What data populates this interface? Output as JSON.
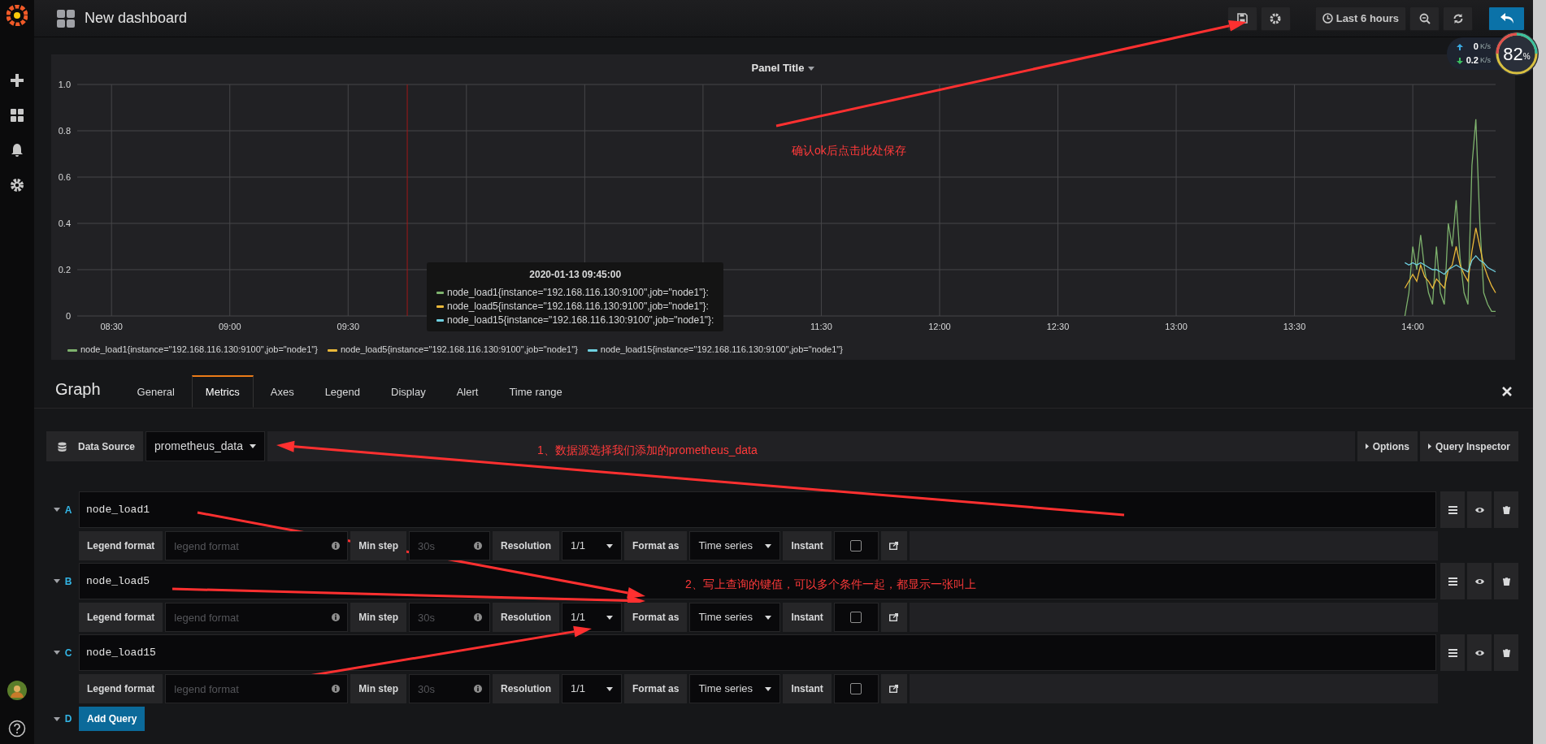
{
  "header": {
    "title": "New dashboard",
    "time_range": "Last 6 hours"
  },
  "net_monitor": {
    "upload": "0",
    "upload_unit": "K/s",
    "download": "0.2",
    "download_unit": "K/s",
    "percent": "82",
    "percent_sign": "%"
  },
  "panel": {
    "title": "Panel Title",
    "chart_data": {
      "type": "line",
      "grid": true,
      "ref_lines": [
        {
          "axis": "x",
          "value": 585,
          "color": "#a01818"
        }
      ],
      "x": [
        838,
        839,
        840,
        841,
        842,
        843,
        844,
        845,
        846,
        847,
        848,
        849,
        850,
        851,
        852,
        853,
        854,
        855,
        856,
        857,
        858,
        859,
        860,
        861
      ],
      "xlim": [
        501.3,
        861
      ],
      "ylim": [
        0,
        1
      ],
      "xticks": [
        {
          "value": 510,
          "label": "08:30"
        },
        {
          "value": 540,
          "label": "09:00"
        },
        {
          "value": 570,
          "label": "09:30"
        },
        {
          "value": 690,
          "label": "11:30"
        },
        {
          "value": 720,
          "label": "12:00"
        },
        {
          "value": 750,
          "label": "12:30"
        },
        {
          "value": 780,
          "label": "13:00"
        },
        {
          "value": 810,
          "label": "13:30"
        },
        {
          "value": 840,
          "label": "14:00"
        }
      ],
      "yticks": [
        {
          "value": 0,
          "label": "0"
        },
        {
          "value": 0.2,
          "label": "0.2"
        },
        {
          "value": 0.4,
          "label": "0.4"
        },
        {
          "value": 0.6,
          "label": "0.6"
        },
        {
          "value": 0.8,
          "label": "0.8"
        },
        {
          "value": 1,
          "label": "1.0"
        }
      ],
      "series": [
        {
          "name": "node_load1{instance=\"192.168.116.130:9100\",job=\"node1\"}",
          "color": "#7eb26d",
          "values": [
            0,
            0.1,
            0.3,
            0.2,
            0.35,
            0.2,
            0.1,
            0.05,
            0.3,
            0.1,
            0.05,
            0.4,
            0.3,
            0.5,
            0.25,
            0.1,
            0.05,
            0.65,
            0.85,
            0.4,
            0.1,
            0.05,
            0.02,
            0.02
          ]
        },
        {
          "name": "node_load5{instance=\"192.168.116.130:9100\",job=\"node1\"}",
          "color": "#eab839",
          "values": [
            0.12,
            0.15,
            0.18,
            0.15,
            0.22,
            0.17,
            0.15,
            0.12,
            0.16,
            0.14,
            0.12,
            0.2,
            0.22,
            0.3,
            0.22,
            0.18,
            0.15,
            0.28,
            0.38,
            0.3,
            0.22,
            0.17,
            0.13,
            0.1
          ]
        },
        {
          "name": "node_load15{instance=\"192.168.116.130:9100\",job=\"node1\"}",
          "color": "#6ed0e0",
          "values": [
            0.23,
            0.22,
            0.23,
            0.22,
            0.23,
            0.22,
            0.21,
            0.2,
            0.2,
            0.19,
            0.18,
            0.2,
            0.21,
            0.22,
            0.21,
            0.2,
            0.19,
            0.24,
            0.26,
            0.24,
            0.23,
            0.21,
            0.2,
            0.19
          ]
        }
      ]
    },
    "tooltip": {
      "time": "2020-01-13 09:45:00",
      "items": [
        {
          "label": "node_load1{instance=\"192.168.116.130:9100\",job=\"node1\"}:",
          "color": "#7eb26d"
        },
        {
          "label": "node_load5{instance=\"192.168.116.130:9100\",job=\"node1\"}:",
          "color": "#eab839"
        },
        {
          "label": "node_load15{instance=\"192.168.116.130:9100\",job=\"node1\"}:",
          "color": "#6ed0e0"
        }
      ]
    }
  },
  "editor": {
    "title": "Graph",
    "tabs": [
      {
        "label": "General",
        "selected": false
      },
      {
        "label": "Metrics",
        "selected": true
      },
      {
        "label": "Axes",
        "selected": false
      },
      {
        "label": "Legend",
        "selected": false
      },
      {
        "label": "Display",
        "selected": false
      },
      {
        "label": "Alert",
        "selected": false
      },
      {
        "label": "Time range",
        "selected": false
      }
    ],
    "data_source": {
      "label": "Data Source",
      "value": "prometheus_data"
    },
    "options_button": "Options",
    "query_inspector_button": "Query Inspector",
    "queries": [
      {
        "letter": "A",
        "expr": "node_load1",
        "legend_format_label": "Legend format",
        "legend_format_placeholder": "legend format",
        "min_step_label": "Min step",
        "min_step_placeholder": "30s",
        "resolution_label": "Resolution",
        "resolution": "1/1",
        "format_as_label": "Format as",
        "format_as": "Time series",
        "instant_label": "Instant",
        "instant": false
      },
      {
        "letter": "B",
        "expr": "node_load5",
        "legend_format_label": "Legend format",
        "legend_format_placeholder": "legend format",
        "min_step_label": "Min step",
        "min_step_placeholder": "30s",
        "resolution_label": "Resolution",
        "resolution": "1/1",
        "format_as_label": "Format as",
        "format_as": "Time series",
        "instant_label": "Instant",
        "instant": false
      },
      {
        "letter": "C",
        "expr": "node_load15",
        "legend_format_label": "Legend format",
        "legend_format_placeholder": "legend format",
        "min_step_label": "Min step",
        "min_step_placeholder": "30s",
        "resolution_label": "Resolution",
        "resolution": "1/1",
        "format_as_label": "Format as",
        "format_as": "Time series",
        "instant_label": "Instant",
        "instant": false
      }
    ],
    "add_query": {
      "letter": "D",
      "label": "Add Query"
    }
  },
  "annotations": [
    {
      "text": "确认ok后点击此处保存"
    },
    {
      "text": "1、数据源选择我们添加的prometheus_data"
    },
    {
      "text": "2、写上查询的键值，可以多个条件一起，都显示一张叫上"
    }
  ]
}
